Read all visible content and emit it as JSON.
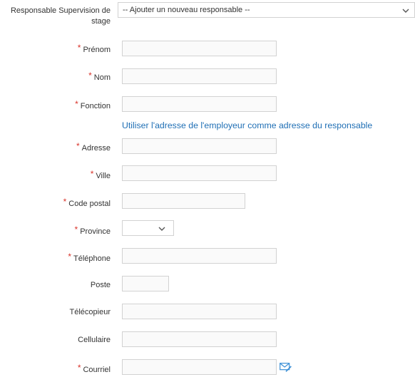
{
  "supervisor": {
    "label_line1": "Responsable Supervision de",
    "label_line2": "stage",
    "select_value": "-- Ajouter un nouveau responsable --"
  },
  "fields": {
    "prenom": "Prénom",
    "nom": "Nom",
    "fonction": "Fonction",
    "adresse": "Adresse",
    "ville": "Ville",
    "code_postal": "Code postal",
    "province": "Province",
    "telephone": "Téléphone",
    "poste": "Poste",
    "telecopieur": "Télécopieur",
    "cellulaire": "Cellulaire",
    "courriel": "Courriel"
  },
  "required_marker": "*",
  "employer_address_link": "Utiliser l'adresse de l'employeur comme adresse du responsable",
  "icons": {
    "select_chevron": "chevron-down-icon",
    "email_edit": "email-edit-icon"
  },
  "colors": {
    "required": "#d9342b",
    "link": "#1f6fb5",
    "email_icon": "#3b8fd6"
  }
}
